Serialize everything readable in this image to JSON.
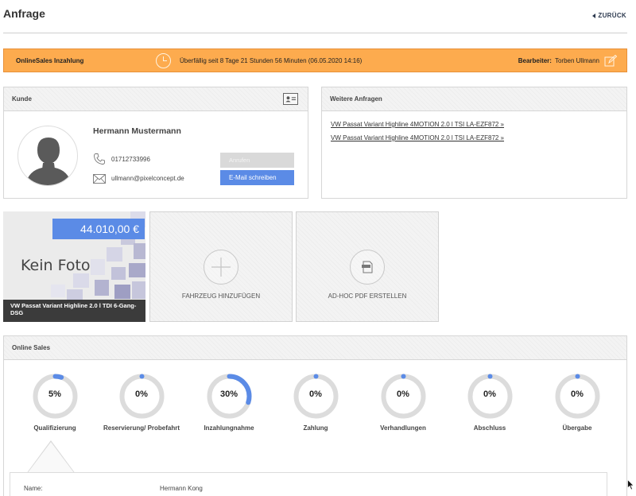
{
  "header": {
    "title": "Anfrage",
    "back_label": "ZURÜCK"
  },
  "status_bar": {
    "title": "OnlineSales Inzahlung",
    "overdue_text": "Überfällig seit 8 Tage 21 Stunden 56 Minuten  (06.05.2020 14:16)",
    "editor_label": "Bearbeiter:",
    "editor_name": "Torben Ullmann",
    "color": "#fdab4e"
  },
  "customer": {
    "panel_title": "Kunde",
    "name": "Hermann Mustermann",
    "phone": "01712733996",
    "email": "ullmann@pixelconcept.de",
    "call_label": "Anrufen",
    "email_label": "E-Mail schreiben"
  },
  "inquiries": {
    "panel_title": "Weitere Anfragen",
    "links": [
      "VW Passat Variant Highline 4MOTION 2.0 l TSI LA-EZF872 »",
      "VW Passat Variant Highline 4MOTION 2.0 l TSI LA-EZF872 »"
    ]
  },
  "vehicle": {
    "price": "44.010,00 €",
    "no_photo": "Kein Foto",
    "caption": "VW Passat Variant Highline 2.0 l TDI 6-Gang-DSG"
  },
  "tiles": {
    "add_vehicle": "FAHRZEUG HINZUFÜGEN",
    "pdf": "AD-HOC PDF ERSTELLEN"
  },
  "online_sales": {
    "panel_title": "Online Sales",
    "accent": "#5b8be6",
    "stages": [
      {
        "label": "Qualifizierung",
        "value": "5%",
        "percent": 5
      },
      {
        "label": "Reservierung/ Probefahrt",
        "value": "0%",
        "percent": 0
      },
      {
        "label": "Inzahlungnahme",
        "value": "30%",
        "percent": 30
      },
      {
        "label": "Zahlung",
        "value": "0%",
        "percent": 0
      },
      {
        "label": "Verhandlungen",
        "value": "0%",
        "percent": 0
      },
      {
        "label": "Abschluss",
        "value": "0%",
        "percent": 0
      },
      {
        "label": "Übergabe",
        "value": "0%",
        "percent": 0
      }
    ],
    "detail": {
      "name_label": "Name:",
      "name_value": "Hermann Kong"
    }
  }
}
